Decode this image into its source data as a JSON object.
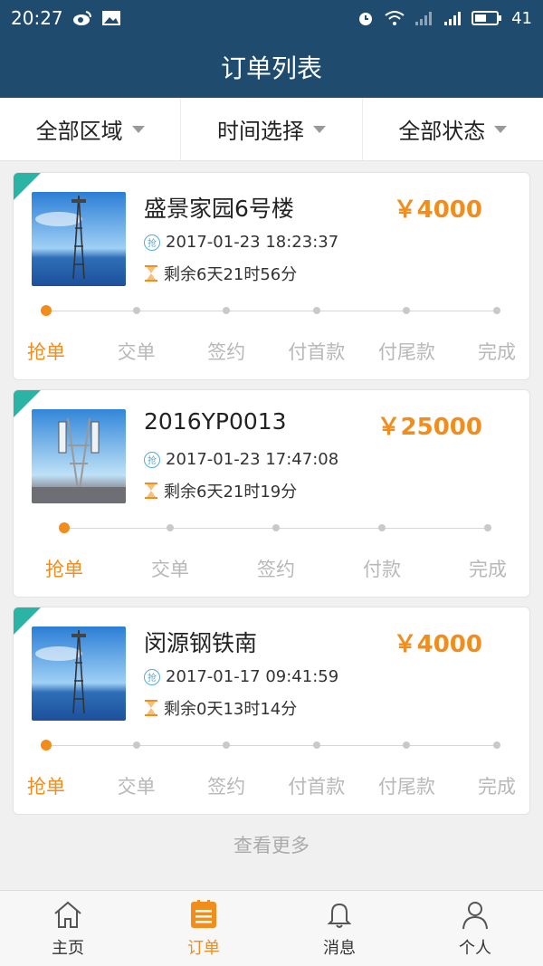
{
  "status_bar": {
    "time": "20:27",
    "battery": "41",
    "network": "4G"
  },
  "header": {
    "title": "订单列表"
  },
  "filters": [
    {
      "label": "全部区域"
    },
    {
      "label": "时间选择"
    },
    {
      "label": "全部状态"
    }
  ],
  "orders": [
    {
      "name": "盛景家园6号楼",
      "price": "￥4000",
      "time": "2017-01-23 18:23:37",
      "remaining": "剩余6天21时56分",
      "steps": [
        "抢单",
        "交单",
        "签约",
        "付首款",
        "付尾款",
        "完成"
      ],
      "active_step": 0
    },
    {
      "name": "2016YP0013",
      "price": "￥25000",
      "time": "2017-01-23 17:47:08",
      "remaining": "剩余6天21时19分",
      "steps": [
        "抢单",
        "交单",
        "签约",
        "付款",
        "完成"
      ],
      "active_step": 0
    },
    {
      "name": "闵源钢铁南",
      "price": "￥4000",
      "time": "2017-01-17 09:41:59",
      "remaining": "剩余0天13时14分",
      "steps": [
        "抢单",
        "交单",
        "签约",
        "付首款",
        "付尾款",
        "完成"
      ],
      "active_step": 0
    }
  ],
  "qiang_badge": "抢",
  "load_more": "查看更多",
  "tabs": [
    {
      "label": "主页",
      "icon": "home-icon"
    },
    {
      "label": "订单",
      "icon": "order-list-icon",
      "active": true
    },
    {
      "label": "消息",
      "icon": "bell-icon"
    },
    {
      "label": "个人",
      "icon": "person-icon"
    }
  ],
  "colors": {
    "header": "#1f4c6e",
    "accent": "#f08d1d",
    "corner": "#2bb3a6"
  }
}
